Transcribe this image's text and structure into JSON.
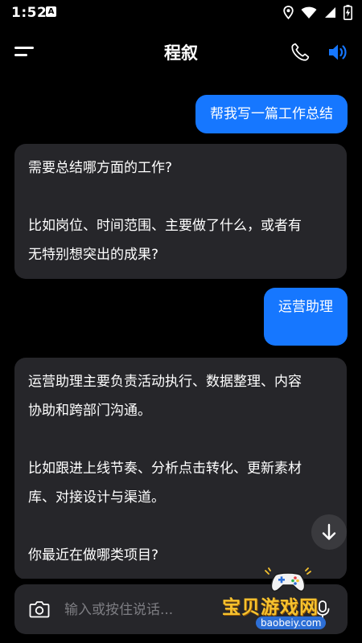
{
  "status_bar": {
    "time": "1:52",
    "notification_letter": "A"
  },
  "header": {
    "title": "程叙",
    "accent_color": "#1677ff"
  },
  "messages": [
    {
      "role": "user",
      "lines": [
        "帮我写一篇工作总结"
      ]
    },
    {
      "role": "assistant",
      "paragraphs": [
        [
          "需要总结哪方面的工作?"
        ],
        [
          "比如岗位、时间范围、主要做了什么，或者有",
          "无特别想突出的成果?"
        ]
      ]
    },
    {
      "role": "user",
      "lines": [
        "运营助理"
      ]
    },
    {
      "role": "assistant",
      "paragraphs": [
        [
          "运营助理主要负责活动执行、数据整理、内容",
          "协助和跨部门沟通。"
        ],
        [
          "比如跟进上线节奏、分析点击转化、更新素材",
          "库、对接设计与渠道。"
        ],
        [
          "你最近在做哪类项目?"
        ]
      ]
    }
  ],
  "composer": {
    "placeholder": "输入或按住说话..."
  },
  "watermark": {
    "main": "宝贝游戏网",
    "sub": "baobeiy.com"
  },
  "colors": {
    "background": "#000000",
    "bot_bubble": "#26262a",
    "user_bubble": "#1677ff"
  }
}
